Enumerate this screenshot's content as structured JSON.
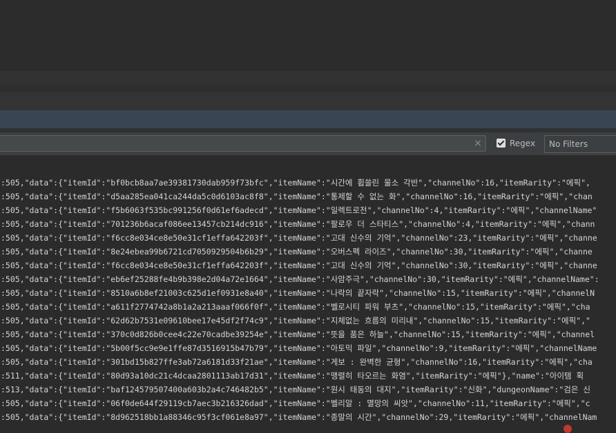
{
  "filter_bar": {
    "search_value": "",
    "clear_icon": "×",
    "regex_label": "Regex",
    "regex_checked": true,
    "filter_dropdown_value": "No Filters"
  },
  "log_lines": [
    ":505,\"data\":{\"itemId\":\"bf0bcb8aa7ae39381730dab959f73bfc\",\"itemName\":\"시간에 휩쓸린 물소 각반\",\"channelNo\":16,\"itemRarity\":\"에픽\",",
    ":505,\"data\":{\"itemId\":\"d5aa285ea041ca244da5c0d6103ac8f8\",\"itemName\":\"통제할 수 없는 화\",\"channelNo\":16,\"itemRarity\":\"에픽\",\"chan",
    ":505,\"data\":{\"itemId\":\"f5b6063f535bc991256f0d61ef6adecd\",\"itemName\":\"일렉트로전\",\"channelNo\":4,\"itemRarity\":\"에픽\",\"channelName\"",
    ":505,\"data\":{\"itemId\":\"701236b6acaf086ee13457cb214dc916\",\"itemName\":\"팔로우 더 스타티스\",\"channelNo\":4,\"itemRarity\":\"에픽\",\"chann",
    ":505,\"data\":{\"itemId\":\"f6cc8e034ce8e50e31cf1effa642203f\",\"itemName\":\"고대 신수의 기억\",\"channelNo\":23,\"itemRarity\":\"에픽\",\"channe",
    ":505,\"data\":{\"itemId\":\"8e24ebea99b6721cd7050929504b6b29\",\"itemName\":\"오버스펙 라이즈\",\"channelNo\":30,\"itemRarity\":\"에픽\",\"channe",
    ":505,\"data\":{\"itemId\":\"f6cc8e034ce8e50e31cf1effa642203f\",\"itemName\":\"고대 신수의 기억\",\"channelNo\":30,\"itemRarity\":\"에픽\",\"channe",
    ":505,\"data\":{\"itemId\":\"eb6ef25288fe4b9b398e2d04a72e1664\",\"itemName\":\"사암주극\",\"channelNo\":30,\"itemRarity\":\"에픽\",\"channelName\":",
    ":505,\"data\":{\"itemId\":\"8510a6b8ef21003c625d1ef0931e8a40\",\"itemName\":\"나락의 끝자락\",\"channelNo\":15,\"itemRarity\":\"에픽\",\"channelN",
    ":505,\"data\":{\"itemId\":\"a611f2774742a8b1a2a213aaaf066f0f\",\"itemName\":\"벨로시티 파워 부츠\",\"channelNo\":15,\"itemRarity\":\"에픽\",\"cha",
    ":505,\"data\":{\"itemId\":\"62d62b7531e09610bee17e45df2f74c9\",\"itemName\":\"지체없는 흐름의 미리내\",\"channelNo\":15,\"itemRarity\":\"에픽\",\"",
    ":505,\"data\":{\"itemId\":\"370c0d826b0cee4c22e70cadbe39254e\",\"itemName\":\"뜻을 품은 하늘\",\"channelNo\":15,\"itemRarity\":\"에픽\",\"channel",
    ":505,\"data\":{\"itemId\":\"5b00f5cc9e9e1ffe87d3516915b47b79\",\"itemName\":\"아토믹 파일\",\"channelNo\":9,\"itemRarity\":\"에픽\",\"channelName",
    ":505,\"data\":{\"itemId\":\"301bd15b827ffe3ab72a6181d33f21ae\",\"itemName\":\"게보 : 완벽한 균형\",\"channelNo\":16,\"itemRarity\":\"에픽\",\"cha",
    ":511,\"data\":{\"itemId\":\"80d93a10dc21c4dcaa2801113ab17d31\",\"itemName\":\"맹렬히 타오르는 화염\",\"itemRarity\":\"에픽\"},\"name\":\"아이템 획",
    ":513,\"data\":{\"itemId\":\"baf124579507400a603b2a4c746482b5\",\"itemName\":\"원시 태동의 대지\",\"itemRarity\":\"신화\",\"dungeonName\":\"검은 신",
    ":505,\"data\":{\"itemId\":\"06f0de644f29119cb7aec3b216326dad\",\"itemName\":\"벨리알 : 멸망의 씨앗\",\"channelNo\":11,\"itemRarity\":\"에픽\",\"c",
    ":505,\"data\":{\"itemId\":\"8d962518bb1a88346c95f3cf061e8a97\",\"itemName\":\"종말의 시간\",\"channelNo\":29,\"itemRarity\":\"에픽\",\"channelNam"
  ]
}
